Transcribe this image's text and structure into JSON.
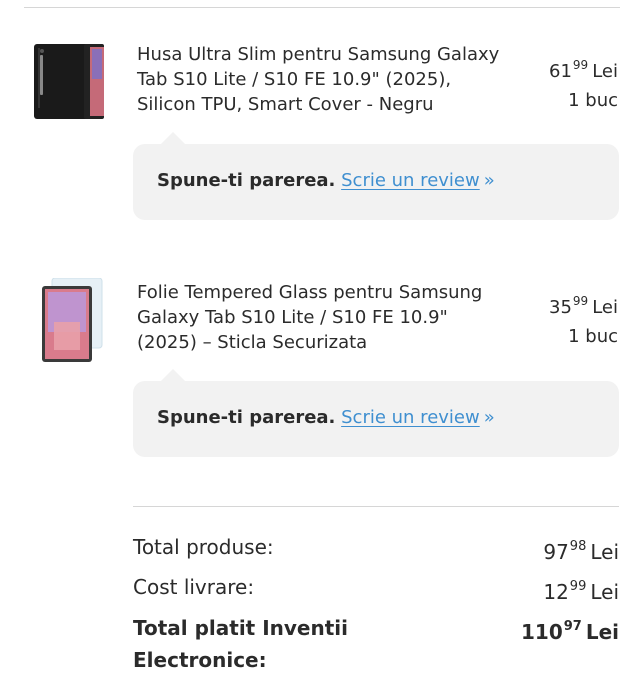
{
  "products": [
    {
      "name": "Husa Ultra Slim pentru Samsung Galaxy Tab S10 Lite / S10 FE 10.9\" (2025), Silicon TPU, Smart Cover - Negru",
      "price_main": "61",
      "price_cents": "99",
      "currency": "Lei",
      "quantity": "1 buc",
      "image_icon": "tablet-case-icon"
    },
    {
      "name": "Folie Tempered Glass pentru Samsung Galaxy Tab S10 Lite / S10 FE 10.9\" (2025) – Sticla Securizata",
      "price_main": "35",
      "price_cents": "99",
      "currency": "Lei",
      "quantity": "1 buc",
      "image_icon": "screen-protector-icon"
    }
  ],
  "review": {
    "prompt": "Spune-ti parerea.",
    "link_label": "Scrie un review",
    "arrow": "»"
  },
  "totals": {
    "products_label": "Total produse:",
    "products_main": "97",
    "products_cents": "98",
    "shipping_label": "Cost livrare:",
    "shipping_main": "12",
    "shipping_cents": "99",
    "paid_label": "Total platit Inventii Electronice:",
    "paid_main": "110",
    "paid_cents": "97",
    "currency": "Lei"
  },
  "colors": {
    "link": "#3f8fd0",
    "review_bg": "#f2f2f2",
    "divider": "#d6d6d6"
  }
}
